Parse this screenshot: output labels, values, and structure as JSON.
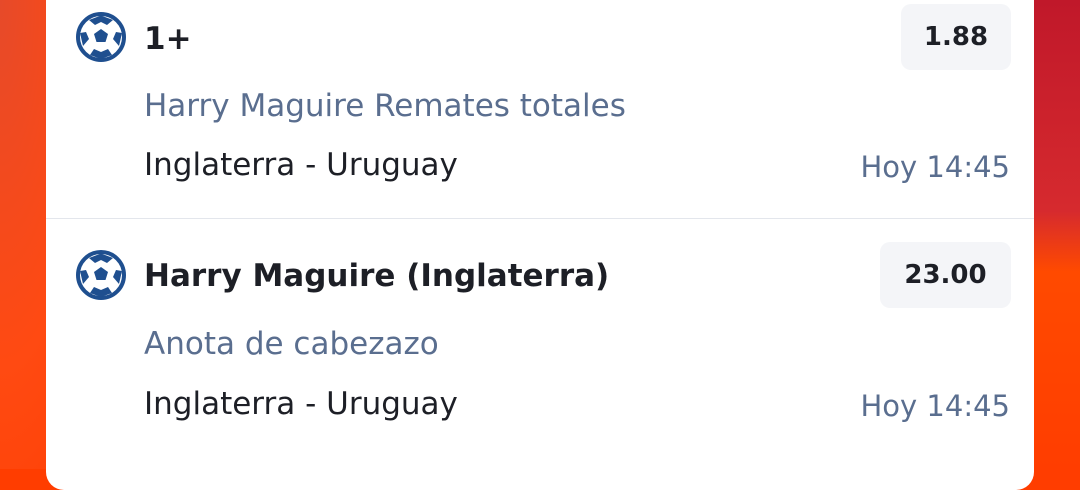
{
  "bets": [
    {
      "icon": "soccer-ball-icon",
      "selection": "1+",
      "odds": "1.88",
      "market": "Harry Maguire Remates totales",
      "match": "Inglaterra - Uruguay",
      "time": "Hoy 14:45"
    },
    {
      "icon": "soccer-ball-icon",
      "selection": "Harry Maguire (Inglaterra)",
      "odds": "23.00",
      "market": "Anota de cabezazo",
      "match": "Inglaterra - Uruguay",
      "time": "Hoy 14:45"
    }
  ],
  "colors": {
    "background": "#ff3d00",
    "card": "#ffffff",
    "ball": "#1f4f8f",
    "market_text": "#5a6e8f",
    "odds_bg": "#f4f5f8"
  }
}
